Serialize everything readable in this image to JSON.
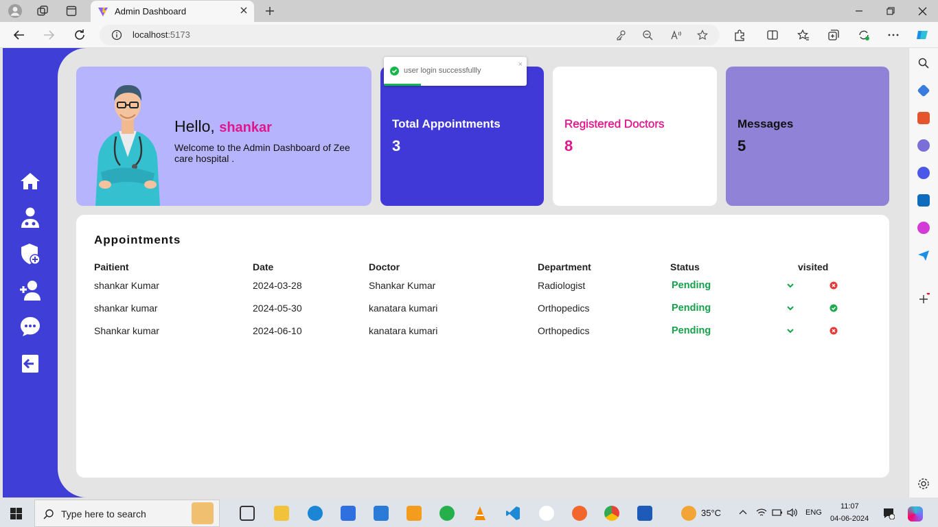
{
  "browser": {
    "tab_title": "Admin Dashboard",
    "url_host": "localhost",
    "url_port": ":5173"
  },
  "toast": {
    "message": "user login successfullly",
    "close_glyph": "×",
    "progress": 0.26
  },
  "greeting": {
    "hello": "Hello,",
    "name": "shankar",
    "welcome": "Welcome to the Admin Dashboard of Zee care hospital ."
  },
  "stats": [
    {
      "label": "Total Appointments",
      "value": "3"
    },
    {
      "label": "Registered Doctors",
      "value": "8"
    },
    {
      "label": "Messages",
      "value": "5"
    }
  ],
  "appointments": {
    "title": "Appointments",
    "headers": [
      "Paitient",
      "Date",
      "Doctor",
      "Department",
      "Status",
      "visited"
    ],
    "rows": [
      {
        "patient": "shankar Kumar",
        "date": "2024-03-28",
        "doctor": "Shankar Kumar",
        "department": "Radiologist",
        "status": "Pending",
        "visited": false
      },
      {
        "patient": "shankar kumar",
        "date": "2024-05-30",
        "doctor": "kanatara kumari",
        "department": "Orthopedics",
        "status": "Pending",
        "visited": true
      },
      {
        "patient": "Shankar kumar",
        "date": "2024-06-10",
        "doctor": "kanatara kumari",
        "department": "Orthopedics",
        "status": "Pending",
        "visited": false
      }
    ]
  },
  "sidebar": {
    "icons": [
      "home-icon",
      "doctors-icon",
      "add-admin-icon",
      "add-doctor-icon",
      "messages-icon",
      "logout-icon"
    ]
  },
  "taskbar": {
    "search_placeholder": "Type here to search",
    "temperature": "35°C",
    "language": "ENG",
    "time": "11:07",
    "date": "04-06-2024"
  },
  "colors": {
    "sidebar": "#3f3ed6",
    "accent_pink": "#e0168e",
    "pending_green": "#14a14a",
    "visited_red": "#e53935",
    "visited_green": "#1faa4b"
  }
}
